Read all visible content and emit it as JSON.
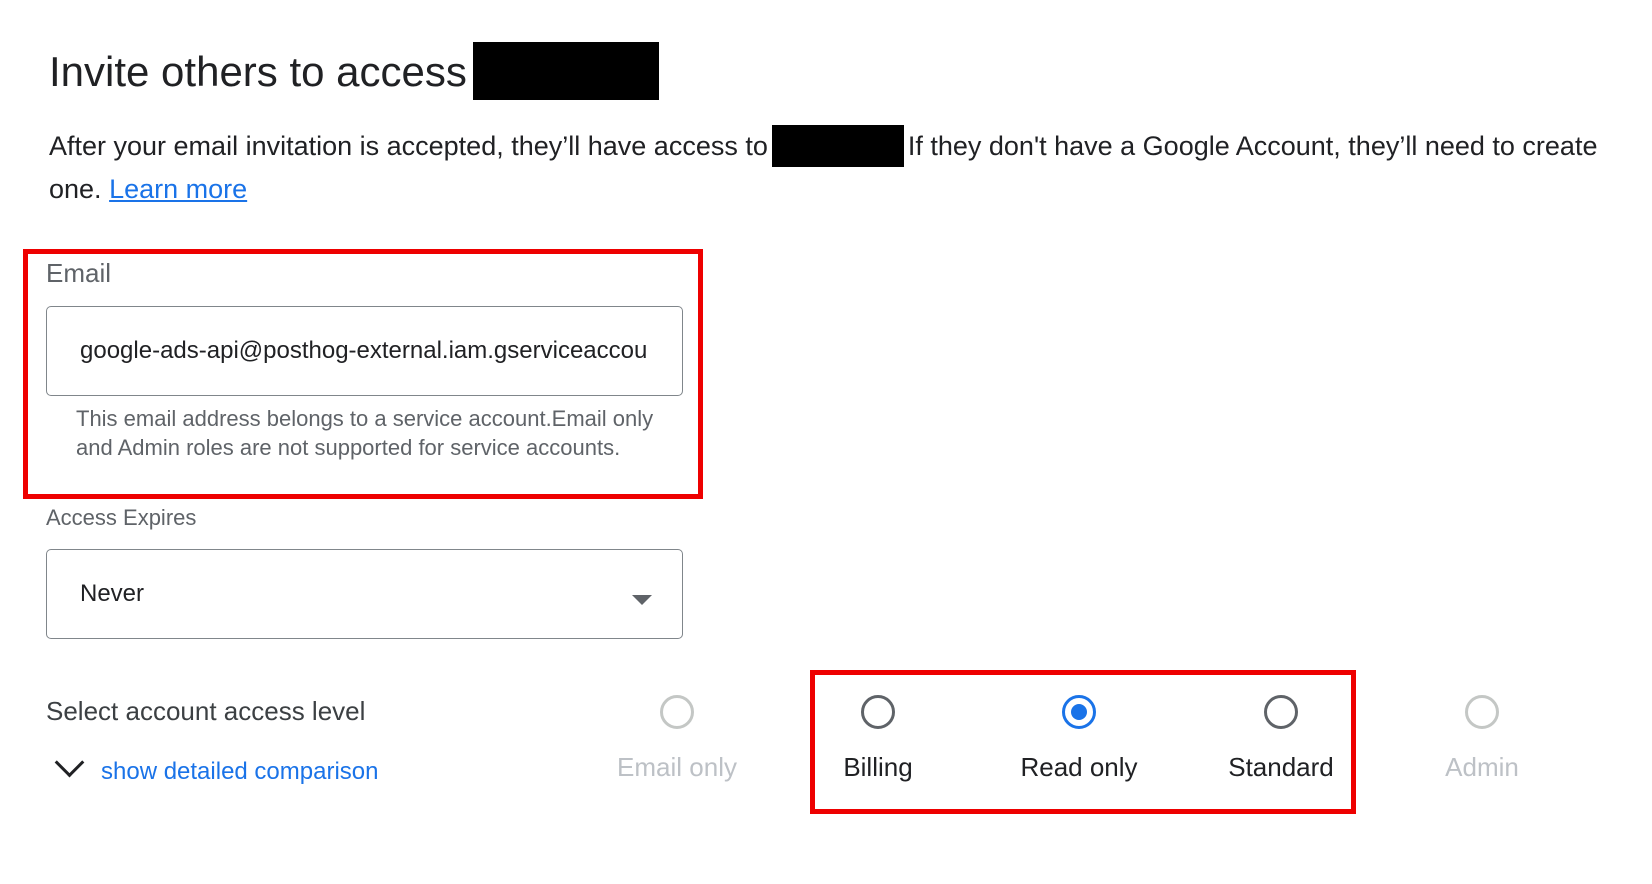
{
  "title": "Invite others to access",
  "description": {
    "before_redaction": "After your email invitation is accepted, they’ll have access to",
    "after_redaction": "If they don't have a Google Account, they’ll need to create one.",
    "learn_more": "Learn more"
  },
  "email": {
    "label": "Email",
    "value": "google-ads-api@posthog-external.iam.gserviceaccount.com",
    "helper": "This email address belongs to a service account.Email only and Admin roles are not supported for service accounts."
  },
  "access_expires": {
    "label": "Access Expires",
    "value": "Never"
  },
  "access_level": {
    "label": "Select account access level",
    "show_comparison": "show detailed comparison",
    "options": [
      {
        "label": "Email only",
        "state": "disabled"
      },
      {
        "label": "Billing",
        "state": "enabled"
      },
      {
        "label": "Read only",
        "state": "selected"
      },
      {
        "label": "Standard",
        "state": "enabled"
      },
      {
        "label": "Admin",
        "state": "disabled"
      }
    ]
  },
  "colors": {
    "accent": "#1a73e8",
    "highlight_box": "#ee0000",
    "redaction": "#000000"
  }
}
